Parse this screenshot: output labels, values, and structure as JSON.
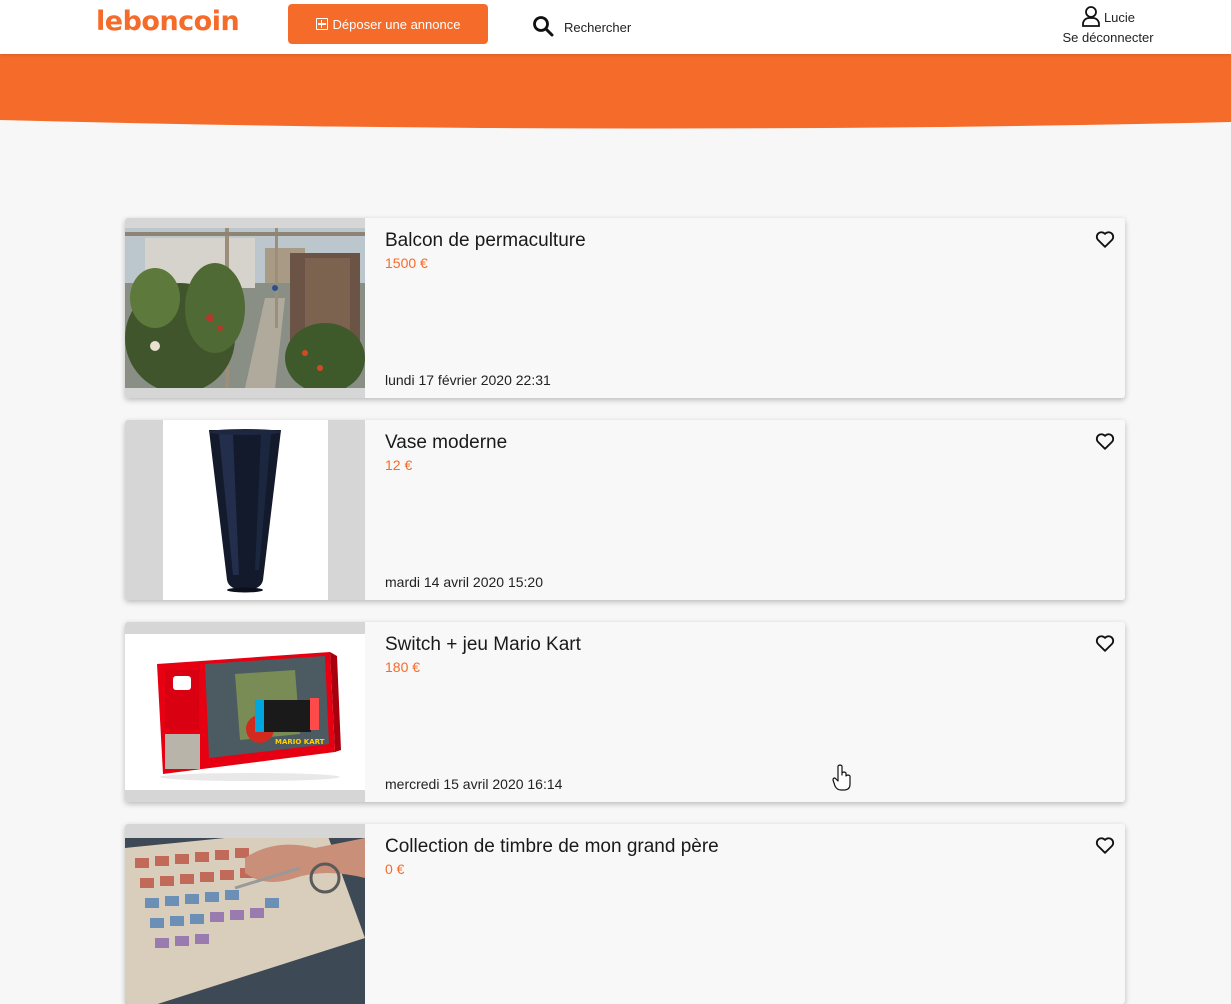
{
  "header": {
    "logo": "leboncoin",
    "post_button": "Déposer une annonce",
    "search_label": "Rechercher",
    "user_name": "Lucie",
    "logout_label": "Se déconnecter"
  },
  "colors": {
    "brand": "#f56b2a",
    "background": "#f7f7f7"
  },
  "listings": [
    {
      "title": "Balcon de permaculture",
      "price": "1500 €",
      "date": "lundi 17 février 2020 22:31",
      "image": "garden-balcony-photo"
    },
    {
      "title": "Vase moderne",
      "price": "12 €",
      "date": "mardi 14 avril 2020 15:20",
      "image": "blue-vase-photo"
    },
    {
      "title": "Switch + jeu Mario Kart",
      "price": "180 €",
      "date": "mercredi 15 avril 2020 16:14",
      "image": "switch-box-photo"
    },
    {
      "title": "Collection de timbre de mon grand père",
      "price": "0 €",
      "date": "",
      "image": "stamps-photo"
    }
  ]
}
